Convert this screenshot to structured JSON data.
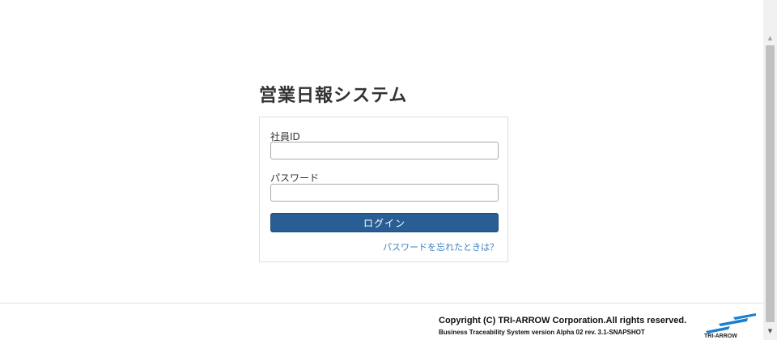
{
  "app": {
    "title": "営業日報システム"
  },
  "login_form": {
    "employee_id_label": "社員ID",
    "employee_id_value": "",
    "password_label": "パスワード",
    "password_value": "",
    "login_button_label": "ログイン",
    "forgot_password_link": "パスワードを忘れたときは？"
  },
  "footer": {
    "copyright": "Copyright (C) TRI-ARROW Corporation.All rights reserved.",
    "version": "Business Traceability System version Alpha 02 rev. 3.1-SNAPSHOT",
    "logo_text": "TRI-ARROW"
  },
  "scrollbar": {
    "up_arrow": "▲",
    "down_arrow": "▼"
  },
  "colors": {
    "accent": "#285e93",
    "link": "#3d7fc1",
    "logo_blue": "#1b7fd0"
  },
  "icons": {
    "logo": "tri-arrow-logo-icon",
    "scroll_up": "scroll-up-arrow-icon",
    "scroll_down": "scroll-down-arrow-icon"
  }
}
